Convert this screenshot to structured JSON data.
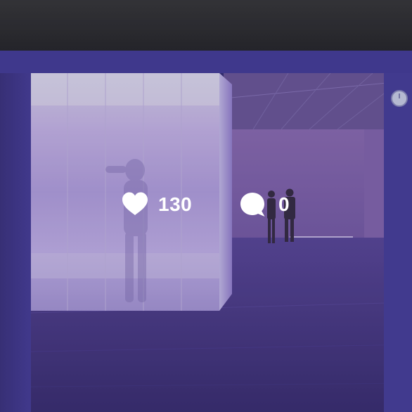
{
  "post": {
    "likes": {
      "count": "130",
      "icon": "heart-icon"
    },
    "comments": {
      "count": "0",
      "icon": "speech-bubble-icon"
    }
  },
  "colors": {
    "text": "#ffffff",
    "overlay": "rgba(0,0,0,0.12)",
    "purple_light": "#b8a6e6",
    "purple_dark": "#3a2f6a"
  }
}
